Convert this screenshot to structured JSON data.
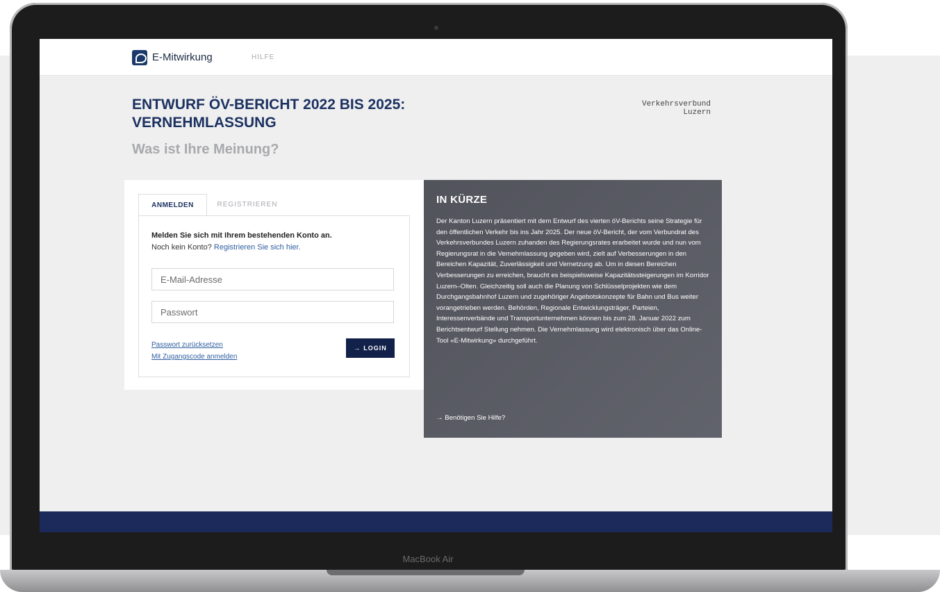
{
  "device": {
    "label": "MacBook Air"
  },
  "nav": {
    "brand": "E-Mitwirkung",
    "help": "HILFE"
  },
  "header": {
    "title": "ENTWURF ÖV-BERICHT 2022 BIS 2025: VERNEHMLASSUNG",
    "subtitle": "Was ist Ihre Meinung?",
    "partner_line1": "Verkehrsverbund",
    "partner_line2": "Luzern"
  },
  "login": {
    "tab_login": "ANMELDEN",
    "tab_register": "REGISTRIEREN",
    "intro": "Melden Sie sich mit Ihrem bestehenden Konto an.",
    "no_account": "Noch kein Konto?",
    "register_link": "Registrieren Sie sich hier.",
    "email_placeholder": "E-Mail-Adresse",
    "password_placeholder": "Passwort",
    "reset_link": "Passwort zurücksetzen",
    "code_link": "Mit Zugangscode anmelden",
    "login_button": "LOGIN",
    "login_arrow": "→"
  },
  "info": {
    "title": "IN KÜRZE",
    "text": "Der Kanton Luzern präsentiert mit dem Entwurf des vierten öV-Berichts seine Strategie für den öffentlichen Verkehr bis ins Jahr 2025. Der neue öV-Bericht, der vom Verbundrat des Verkehrsverbundes Luzern zuhanden des Regierungsrates erarbeitet wurde und nun vom Regierungsrat in die Vernehmlassung gegeben wird, zielt auf Verbesserungen in den Bereichen Kapazität, Zuverlässigkeit und Vernetzung ab. Um in diesen Bereichen Verbesserungen zu erreichen, braucht es beispielsweise Kapazitätssteigerungen im Korridor Luzern–Olten. Gleichzeitig soll auch die Planung von Schlüsselprojekten wie dem Durchgangsbahnhof Luzern und zugehöriger Angebotskonzepte für Bahn und Bus weiter vorangetrieben werden. Behörden, Regionale Entwicklungsträger, Parteien, Interessenverbände und Transportunternehmen können bis zum 28. Januar 2022 zum Berichtsentwurf Stellung nehmen. Die Vernehmlassung wird elektronisch über das Online-Tool «E-Mitwirkung» durchgeführt.",
    "help_link": "→ Benötigen Sie Hilfe?"
  },
  "colors": {
    "navy": "#1b3160",
    "button": "#12214a",
    "info_bg": "#5b5d66"
  }
}
